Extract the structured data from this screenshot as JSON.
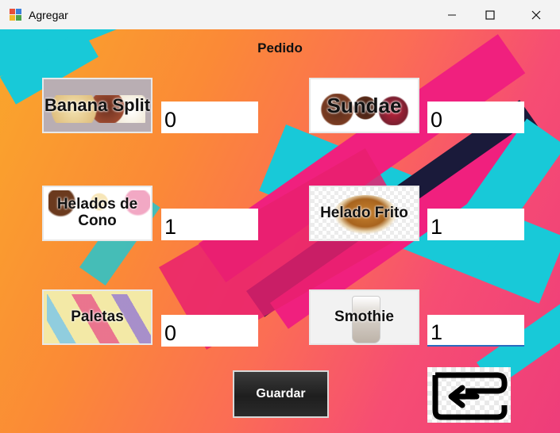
{
  "window": {
    "title": "Agregar",
    "minimize_icon": "minimize-icon",
    "maximize_icon": "maximize-icon",
    "close_icon": "close-icon"
  },
  "form": {
    "heading": "Pedido",
    "items": [
      {
        "label": "Banana Split",
        "quantity": "0"
      },
      {
        "label": "Sundae",
        "quantity": "0"
      },
      {
        "label": "Helados de Cono",
        "quantity": "1"
      },
      {
        "label": "Helado Frito",
        "quantity": "1"
      },
      {
        "label": "Paletas",
        "quantity": "0"
      },
      {
        "label": "Smothie",
        "quantity": "1"
      }
    ],
    "save_label": "Guardar",
    "back_icon": "back-arrow-icon"
  },
  "colors": {
    "background_start": "#f9a72b",
    "background_end": "#ee3d7a",
    "stripe_cyan": "#18c9d8",
    "stripe_pink": "#f0207e",
    "focus_underline": "#2a6bbf"
  }
}
